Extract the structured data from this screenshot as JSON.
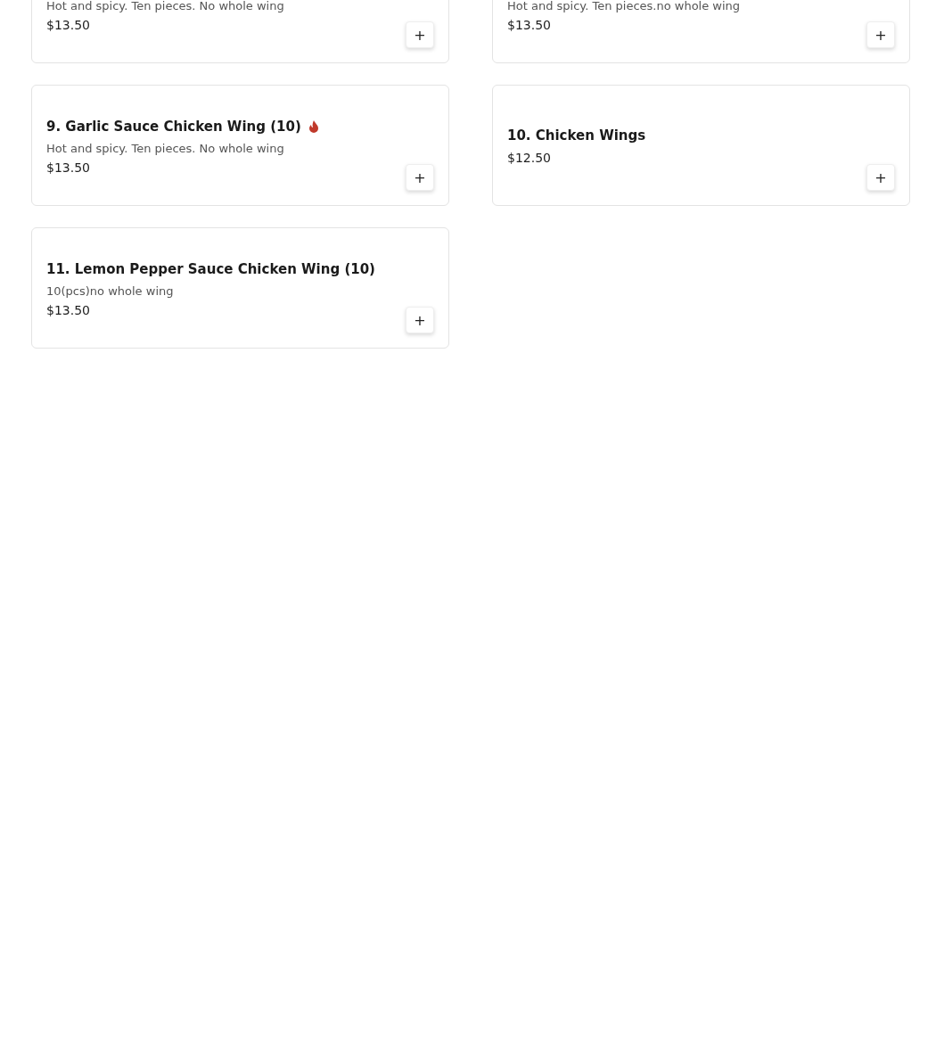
{
  "items": [
    {
      "description": "Hot and spicy. Ten pieces. No whole wing",
      "price": "$13.50",
      "add_label": "+"
    },
    {
      "description": "Hot and spicy. Ten pieces.no whole wing",
      "price": "$13.50",
      "add_label": "+"
    },
    {
      "title": "9. Garlic Sauce Chicken Wing (10)",
      "description": "Hot and spicy. Ten pieces. No whole wing",
      "price": "$13.50",
      "add_label": "+",
      "spicy": true
    },
    {
      "title": "10. Chicken Wings",
      "price": "$12.50",
      "add_label": "+",
      "spicy": false
    },
    {
      "title": "11. Lemon Pepper Sauce Chicken Wing (10)",
      "description": "10(pcs)no whole wing",
      "price": "$13.50",
      "add_label": "+",
      "spicy": false
    }
  ]
}
